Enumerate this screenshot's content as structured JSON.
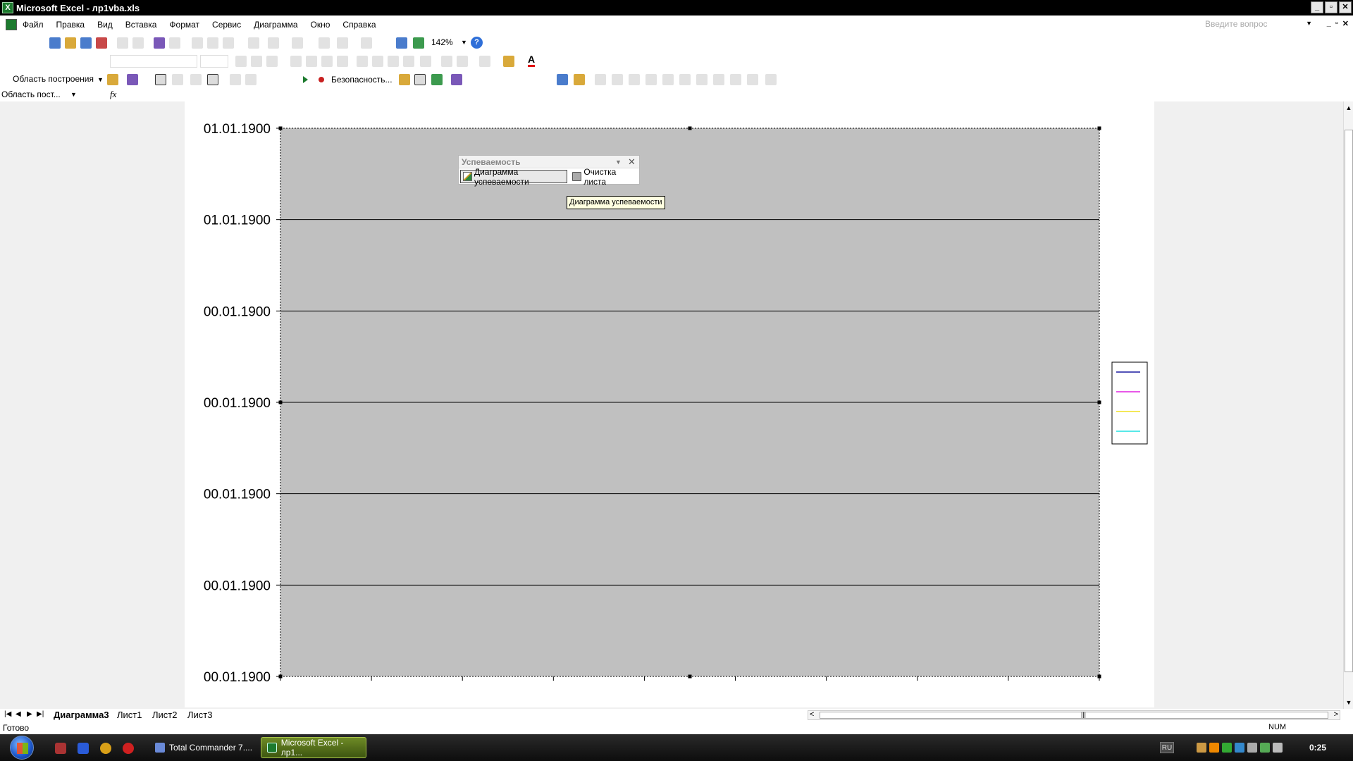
{
  "window": {
    "title": "Microsoft Excel - лр1vba.xls",
    "app_icon_letter": "X"
  },
  "menu": {
    "items": [
      "Файл",
      "Правка",
      "Вид",
      "Вставка",
      "Формат",
      "Сервис",
      "Диаграмма",
      "Окно",
      "Справка"
    ],
    "ask_placeholder": "Введите вопрос"
  },
  "toolbar": {
    "zoom": "142%",
    "chart_object": "Область построения",
    "security": "Безопасность..."
  },
  "formula_bar": {
    "name_box": "Область пост...",
    "fx": "fx"
  },
  "chart_data": {
    "type": "line",
    "y_tick_labels": [
      "01.01.1900",
      "01.01.1900",
      "00.01.1900",
      "00.01.1900",
      "00.01.1900",
      "00.01.1900",
      "00.01.1900"
    ],
    "x_tick_count": 9,
    "series": [
      {
        "color": "#1a1aa0",
        "values": []
      },
      {
        "color": "#e020e0",
        "values": []
      },
      {
        "color": "#f0e020",
        "values": []
      },
      {
        "color": "#20e0e0",
        "values": []
      }
    ],
    "plot_area_color": "#c0c0c0",
    "grid": true,
    "legend": "right"
  },
  "floating_toolbar": {
    "title": "Успеваемость",
    "buttons": [
      "Диаграмма успеваемости",
      "Очистка листа"
    ],
    "tooltip": "Диаграмма успеваемости"
  },
  "sheets": {
    "tabs": [
      "Диаграмма3",
      "Лист1",
      "Лист2",
      "Лист3"
    ],
    "active": 0
  },
  "status": {
    "ready": "Готово",
    "num": "NUM"
  },
  "taskbar": {
    "tasks": [
      "Total Commander 7....",
      "Microsoft Excel - лр1..."
    ],
    "lang": "RU",
    "clock": "0:25"
  }
}
